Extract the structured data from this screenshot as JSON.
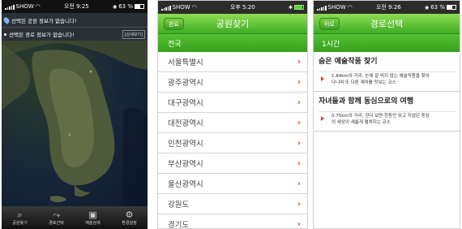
{
  "screen1": {
    "status": {
      "carrier": "SHOW",
      "time": "오전 9:25",
      "battery": "63 %"
    },
    "banner_parks": "선택된 공원 정보가 없습니다!",
    "banner_routes": "선택된 경로 정보가 없습니다!",
    "detail_button": "[상세보기]",
    "tabs": [
      {
        "label": "공원찾기",
        "icon": "search-icon"
      },
      {
        "label": "경로선택",
        "icon": "route-icon"
      },
      {
        "label": "예술검색",
        "icon": "image-icon"
      },
      {
        "label": "환경설정",
        "icon": "gear-icon"
      }
    ]
  },
  "screen2": {
    "status": {
      "carrier": "SHOW",
      "time": "오후 5:20"
    },
    "nav_button": "완료",
    "title": "공원찾기",
    "section": "전국",
    "cities": [
      "서울특별시",
      "광주광역시",
      "대구광역시",
      "대전광역시",
      "인천광역시",
      "부산광역시",
      "울산광역시",
      "강원도",
      "경기도"
    ]
  },
  "screen3": {
    "status": {
      "carrier": "SHOW",
      "time": "오전 9:26",
      "battery": "63 %"
    },
    "nav_button": "뒤로",
    "title": "경로선택",
    "section": "1시간",
    "courses": [
      {
        "title": "숨은 예술작품 찾기",
        "desc_line1": "1.84km의 거리, 눈에 잘 띄지 않는 예술작품을 찾아",
        "desc_line2": "다니며 또 다른 재미를 맛보는 코스"
      },
      {
        "title": "자녀들과 함께 동심으로의 여행",
        "desc_line1": "0.75km의 거리, 걷다 보면 한동안 잊고 지냈던 동심",
        "desc_line2": "의 세상이 새롭게 펼쳐지는 코스"
      }
    ]
  },
  "colors": {
    "nav_green": "#3fae24",
    "chevron": "#e2401f",
    "map_bg": "#0f1f33"
  }
}
